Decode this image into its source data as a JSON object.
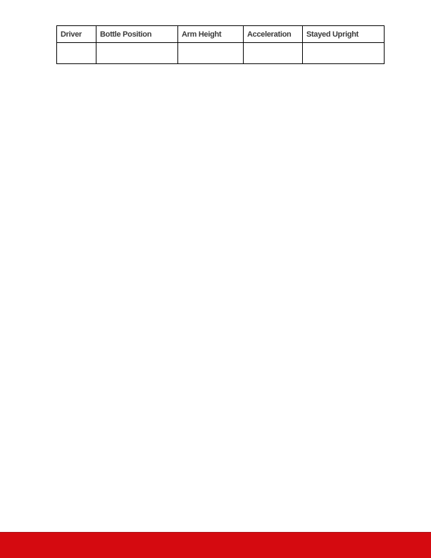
{
  "table": {
    "columns": [
      "Driver",
      "Bottle Position",
      "Arm Height",
      "Acceleration",
      "Stayed Upright"
    ],
    "rows": [
      [
        "",
        "",
        "",
        "",
        ""
      ]
    ]
  },
  "footer": {
    "color": "#d50a10"
  }
}
